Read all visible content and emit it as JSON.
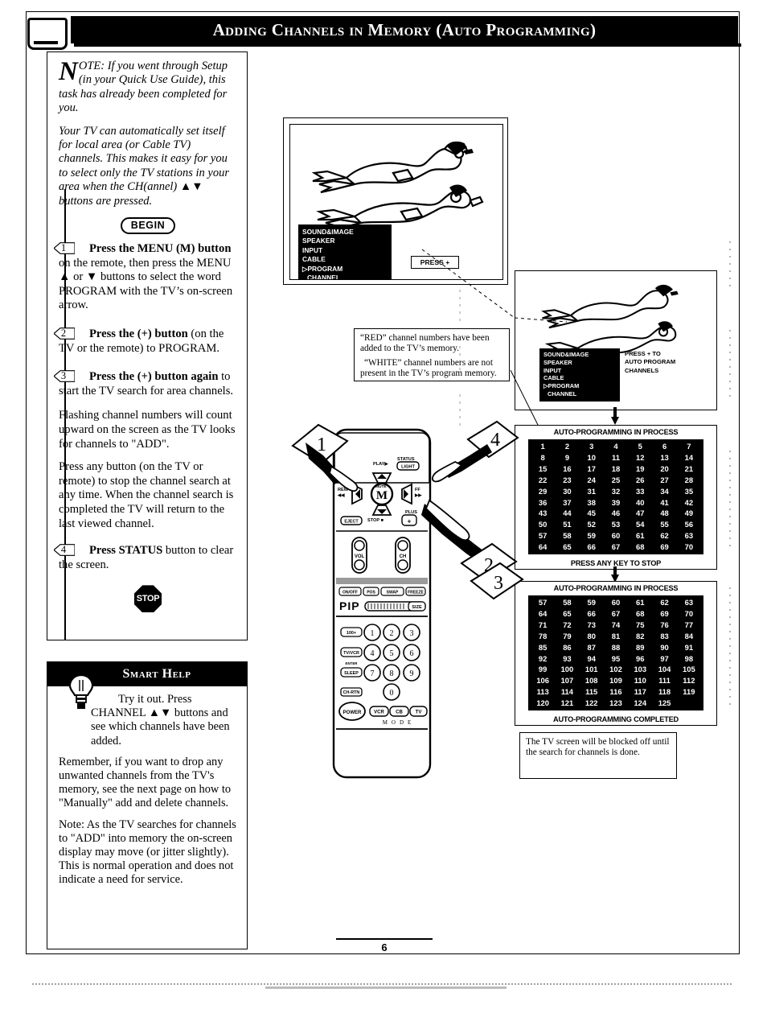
{
  "page": {
    "header_title": "Adding Channels in Memory (Auto Programming)",
    "page_number": "6",
    "tv_icon": "tv-screen-icon"
  },
  "note_panel": {
    "dropcap": "N",
    "paragraphs": [
      "OTE: If you went through Setup (in your Quick Use Guide), this task has already been completed for you.",
      "Your TV can automatically set itself for local area (or Cable TV) channels. This makes it easy for you to select only the TV stations in your area when the CH(annel) ▲▼ buttons are pressed."
    ],
    "begin_label": "BEGIN",
    "steps": [
      {
        "number": "1",
        "bold_lead": "Press the MENU (M) button",
        "rest": " on the remote, then press the MENU ▲ or ▼ buttons to select the word PROGRAM with the TV’s on-screen arrow."
      },
      {
        "number": "2",
        "bold_lead": "Press the (+) button",
        "rest": " (on the TV or the remote) to PROGRAM."
      },
      {
        "number": "3",
        "bold_lead": "Press the (+) button again",
        "rest": " to start the TV search for area channels."
      }
    ],
    "extra_paragraphs": [
      "Flashing channel numbers will count upward on the screen as the TV looks for channels to \"ADD\".",
      "Press any button (on the TV or remote) to stop the channel search at any time. When the channel search is completed the TV will return to the last viewed channel."
    ],
    "step4": {
      "number": "4",
      "bold_lead": "Press STATUS",
      "rest": " button to clear the screen."
    },
    "stop_label": "STOP"
  },
  "help_panel": {
    "title": "Smart Help",
    "bulb_icon": "lightbulb-icon",
    "paragraphs": [
      "Try it out.  Press CHANNEL ▲▼ buttons and see which channels have been added.",
      "Remember, if you want to drop any unwanted channels from the TV's memory, see the next page on how to \"Manually\" add and delete channels.",
      "Note: As the TV searches for channels to \"ADD\" into memory the on-screen display may move (or jitter slightly). This is normal operation and does not indicate a need for service."
    ]
  },
  "figures": {
    "tv_screen_1": {
      "name": "tv-menu-screen",
      "osd_items": [
        "SOUND&IMAGE",
        "SPEAKER",
        "INPUT",
        "CABLE",
        "▷PROGRAM",
        "CHANNEL"
      ],
      "press_box": "PRESS +",
      "illustration": "divers-illustration"
    },
    "tv_screen_2": {
      "name": "tv-menu-screen-auto-program",
      "osd_items": [
        "SOUND&IMAGE",
        "SPEAKER",
        "INPUT",
        "CABLE",
        "▷PROGRAM",
        "CHANNEL"
      ],
      "press_lines": [
        "PRESS + TO",
        "AUTO PROGRAM",
        "CHANNELS"
      ],
      "illustration": "divers-illustration"
    },
    "red_white_callout": [
      "“RED” channel numbers have been added to the TV’s memory.",
      "“WHITE” channel numbers are not present in the TV’s program memory."
    ],
    "blocked_callout": [
      "The TV screen will be blocked off until the search for channels is done."
    ],
    "remote": {
      "name": "remote-control",
      "labels": {
        "play": "PLAY▶",
        "status": "STATUS",
        "light": "LIGHT",
        "rew": "REW",
        "rew_sym": "◀◀",
        "ff": "FF",
        "ff_sym": "▶▶",
        "menu_top": "MUTE",
        "menu": "M",
        "stop": "STOP ■",
        "eject": "EJECT",
        "plus": "PLUS",
        "plus_sym": "+",
        "vol": "VOL",
        "ch": "CH",
        "pip_row": [
          "ON/OFF",
          "POS",
          "SWAP",
          "FREEZE"
        ],
        "pip": "PIP",
        "size": "SIZE",
        "hundred": "100+",
        "tv_vcr": "TV/VCR",
        "enter": "ENTER",
        "sleep": "SLEEP",
        "ch_rtn": "CH-RTN",
        "power": "POWER",
        "mode_buttons": [
          "VCR",
          "CB",
          "TV"
        ],
        "mode_label": "M   O   D   E",
        "keypad": [
          "1",
          "2",
          "3",
          "4",
          "5",
          "6",
          "7",
          "8",
          "9",
          "0"
        ]
      }
    },
    "callout_numbers": [
      "1",
      "4",
      "2",
      "3"
    ]
  },
  "chart_data": [
    {
      "type": "table",
      "name": "auto-programming-grid-in-process",
      "title": "AUTO-PROGRAMMING IN PROCESS",
      "footer": "PRESS ANY KEY TO STOP",
      "columns": 7,
      "rows": [
        [
          "1",
          "2",
          "3",
          "4",
          "5",
          "6",
          "7"
        ],
        [
          "8",
          "9",
          "10",
          "11",
          "12",
          "13",
          "14"
        ],
        [
          "15",
          "16",
          "17",
          "18",
          "19",
          "20",
          "21"
        ],
        [
          "22",
          "23",
          "24",
          "25",
          "26",
          "27",
          "28"
        ],
        [
          "29",
          "30",
          "31",
          "32",
          "33",
          "34",
          "35"
        ],
        [
          "36",
          "37",
          "38",
          "39",
          "40",
          "41",
          "42"
        ],
        [
          "43",
          "44",
          "45",
          "46",
          "47",
          "48",
          "49"
        ],
        [
          "50",
          "51",
          "52",
          "53",
          "54",
          "55",
          "56"
        ],
        [
          "57",
          "58",
          "59",
          "60",
          "61",
          "62",
          "63"
        ],
        [
          "64",
          "65",
          "66",
          "67",
          "68",
          "69",
          "70"
        ]
      ]
    },
    {
      "type": "table",
      "name": "auto-programming-grid-completed",
      "title": "AUTO-PROGRAMMING IN PROCESS",
      "footer": "AUTO-PROGRAMMING COMPLETED",
      "columns": 7,
      "rows": [
        [
          "57",
          "58",
          "59",
          "60",
          "61",
          "62",
          "63"
        ],
        [
          "64",
          "65",
          "66",
          "67",
          "68",
          "69",
          "70"
        ],
        [
          "71",
          "72",
          "73",
          "74",
          "75",
          "76",
          "77"
        ],
        [
          "78",
          "79",
          "80",
          "81",
          "82",
          "83",
          "84"
        ],
        [
          "85",
          "86",
          "87",
          "88",
          "89",
          "90",
          "91"
        ],
        [
          "92",
          "93",
          "94",
          "95",
          "96",
          "97",
          "98"
        ],
        [
          "99",
          "100",
          "101",
          "102",
          "103",
          "104",
          "105"
        ],
        [
          "106",
          "107",
          "108",
          "109",
          "110",
          "111",
          "112"
        ],
        [
          "113",
          "114",
          "115",
          "116",
          "117",
          "118",
          "119"
        ],
        [
          "120",
          "121",
          "122",
          "123",
          "124",
          "125",
          ""
        ]
      ]
    }
  ]
}
